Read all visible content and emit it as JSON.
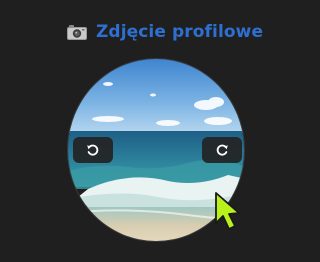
{
  "profile_photo": {
    "heading": "Zdjęcie profilowe",
    "heading_icon": "camera-icon",
    "title_color": "#2f6fd0"
  },
  "controls": {
    "rotate_left_icon": "rotate-left-icon",
    "rotate_right_icon": "rotate-right-icon"
  },
  "cursor": {
    "icon": "pointer-cursor-icon",
    "color": "#b8f21a"
  }
}
